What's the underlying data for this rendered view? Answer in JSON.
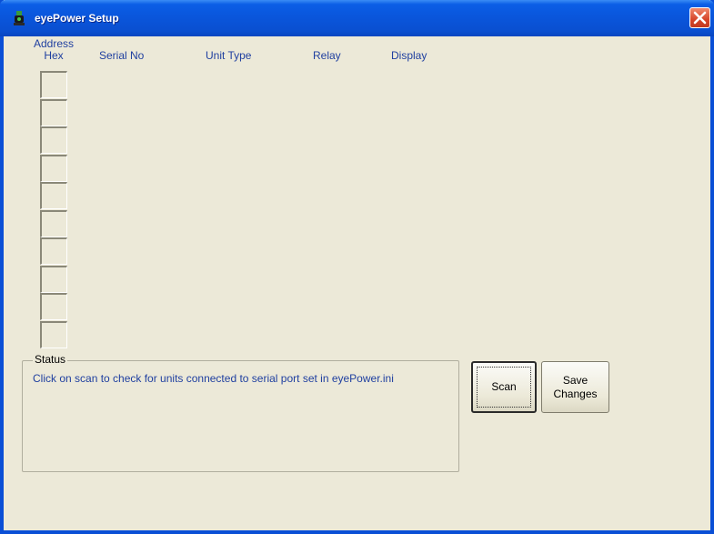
{
  "window": {
    "title": "eyePower Setup",
    "app_icon": "eyepower-app-icon",
    "close_icon": "close-icon"
  },
  "table": {
    "headers": {
      "address_line1": "Address",
      "address_line2": "Hex",
      "serial": "Serial No",
      "unit_type": "Unit Type",
      "relay": "Relay",
      "display": "Display"
    },
    "address_cells": [
      "",
      "",
      "",
      "",
      "",
      "",
      "",
      "",
      "",
      ""
    ]
  },
  "status": {
    "legend": "Status",
    "message": "Click on scan to check for units connected to serial port set in eyePower.ini"
  },
  "buttons": {
    "scan": "Scan",
    "save_line1": "Save",
    "save_line2": "Changes"
  },
  "colors": {
    "titlebar": "#0a56dc",
    "face": "#ece9d8",
    "header_text": "#2040a0",
    "close_button": "#d6452a"
  }
}
